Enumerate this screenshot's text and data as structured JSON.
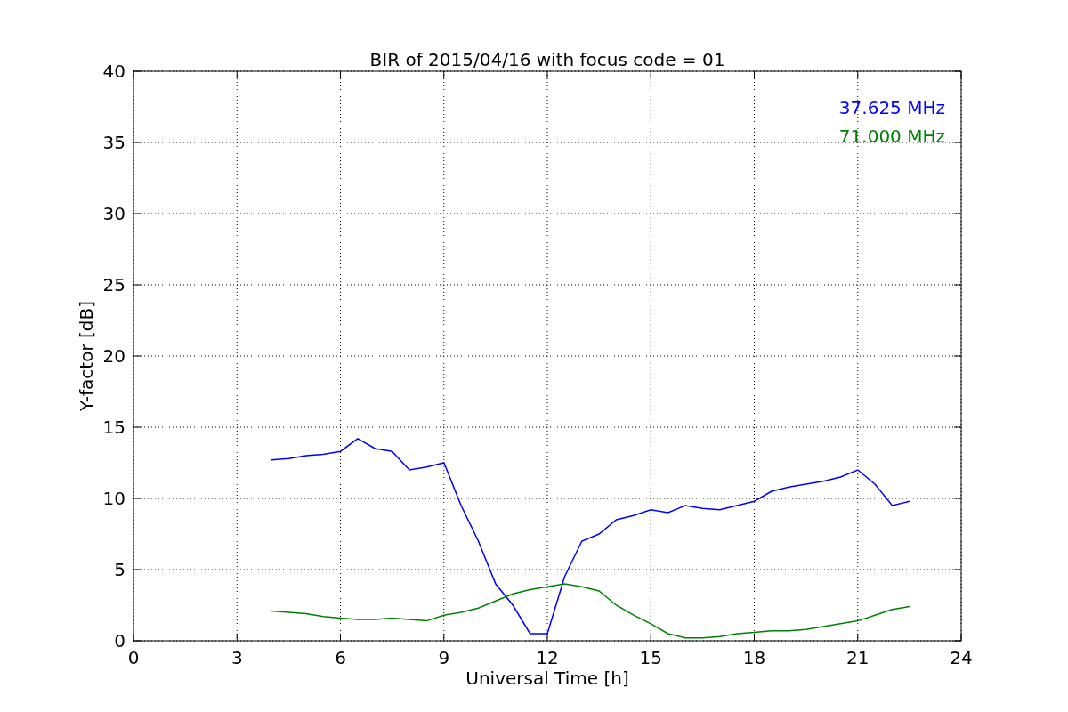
{
  "chart_data": {
    "type": "line",
    "title": "BIR of 2015/04/16 with focus code = 01",
    "xlabel": "Universal Time [h]",
    "ylabel": "Y-factor [dB]",
    "x": [
      4,
      4.5,
      5,
      5.5,
      6,
      6.5,
      7,
      7.5,
      8,
      8.5,
      9,
      9.5,
      10,
      10.5,
      11,
      11.5,
      12,
      12.5,
      13,
      13.5,
      14,
      14.5,
      15,
      15.5,
      16,
      16.5,
      17,
      17.5,
      18,
      18.5,
      19,
      19.5,
      20,
      20.5,
      21,
      21.5,
      22,
      22.5
    ],
    "series": [
      {
        "name": "37.625 MHz",
        "color": "#0000ff",
        "values": [
          12.7,
          12.8,
          13,
          13.1,
          13.3,
          14.2,
          13.5,
          13.3,
          12,
          12.2,
          12.5,
          9.5,
          7,
          4,
          2.5,
          0.5,
          0.5,
          4.5,
          7,
          7.5,
          8.5,
          8.8,
          9.2,
          9,
          9.5,
          9.3,
          9.2,
          9.5,
          9.8,
          10.5,
          10.8,
          11,
          11.2,
          11.5,
          12,
          11,
          9.5,
          9.8
        ]
      },
      {
        "name": "71.000 MHz",
        "color": "#008000",
        "values": [
          2.1,
          2.0,
          1.9,
          1.7,
          1.6,
          1.5,
          1.5,
          1.6,
          1.5,
          1.4,
          1.8,
          2.0,
          2.3,
          2.8,
          3.3,
          3.6,
          3.8,
          4.0,
          3.8,
          3.5,
          2.5,
          1.8,
          1.2,
          0.5,
          0.2,
          0.2,
          0.3,
          0.5,
          0.6,
          0.7,
          0.7,
          0.8,
          1.0,
          1.2,
          1.4,
          1.8,
          2.2,
          2.4
        ]
      }
    ],
    "xlim": [
      0,
      24
    ],
    "ylim": [
      0,
      40
    ],
    "grid": true,
    "xticks": [
      0,
      3,
      6,
      9,
      12,
      15,
      18,
      21,
      24
    ],
    "yticks": [
      0,
      5,
      10,
      15,
      20,
      25,
      30,
      35,
      40
    ]
  }
}
